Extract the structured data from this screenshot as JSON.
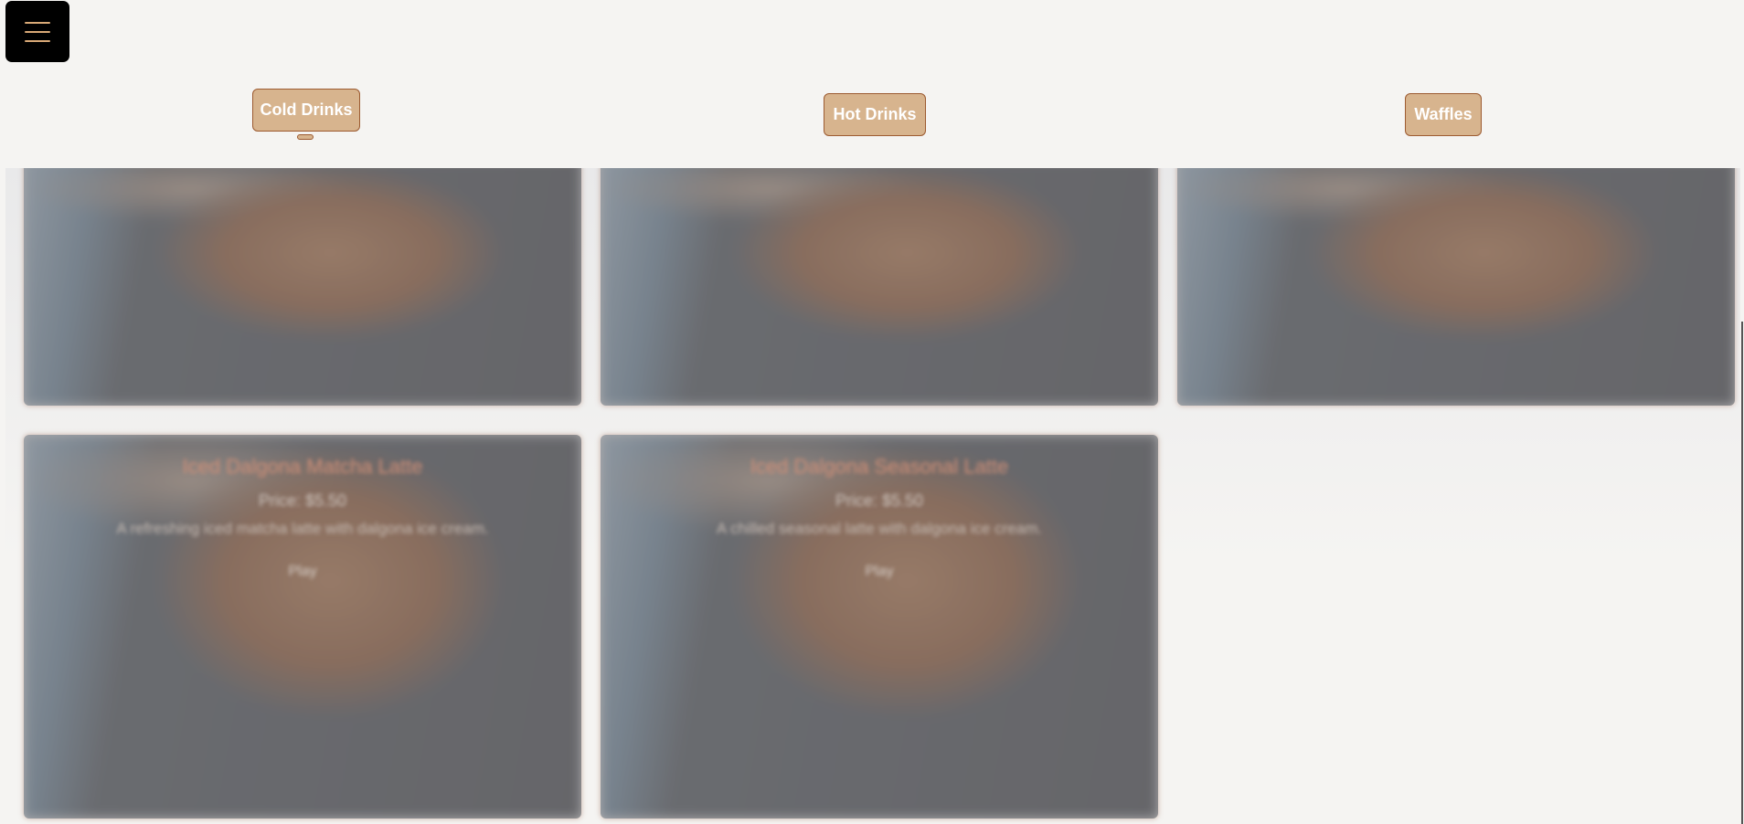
{
  "nav": {
    "menu_icon": "hamburger-menu-icon",
    "tabs": [
      {
        "label": "Cold Drinks",
        "active": true
      },
      {
        "label": "Hot Drinks",
        "active": false
      },
      {
        "label": "Waffles",
        "active": false
      }
    ]
  },
  "colors": {
    "accent": "#d7b48e",
    "accent_border": "#9c5a30",
    "title_text": "#cf8f78"
  },
  "products": [
    {
      "title": "",
      "price": "",
      "description": "",
      "play_label": ""
    },
    {
      "title": "",
      "price": "",
      "description": "",
      "play_label": ""
    },
    {
      "title": "",
      "price": "",
      "description": "",
      "play_label": ""
    },
    {
      "title": "Iced Dalgona Matcha Latte",
      "price": "Price: $5.50",
      "description": "A refreshing iced matcha latte with dalgona ice cream.",
      "play_label": "Play"
    },
    {
      "title": "Iced Dalgona Seasonal Latte",
      "price": "Price: $5.50",
      "description": "A chilled seasonal latte with dalgona ice cream.",
      "play_label": "Play"
    }
  ]
}
